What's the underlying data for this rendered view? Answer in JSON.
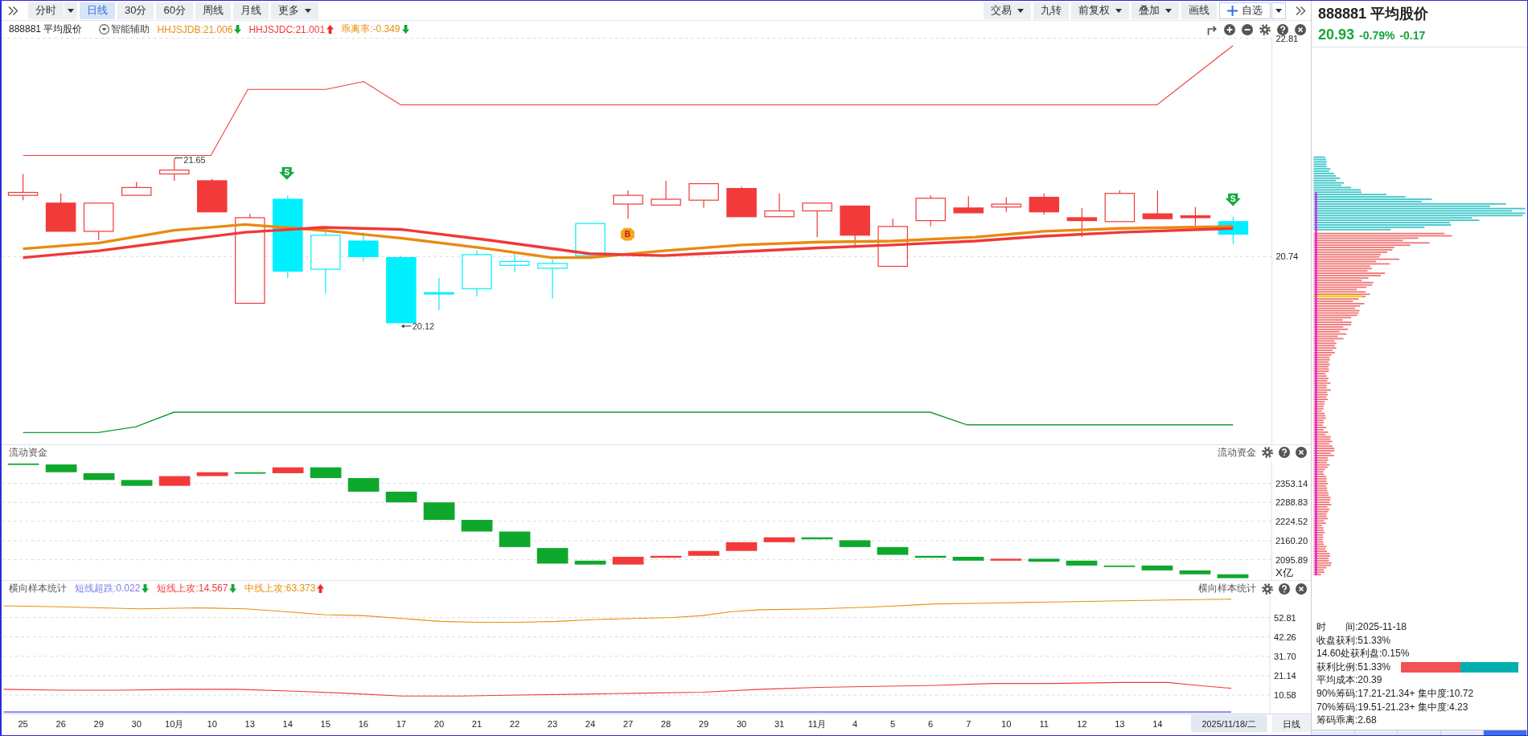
{
  "toolbar": {
    "left": [
      {
        "label": "分时",
        "kind": "split",
        "selected": false
      },
      {
        "label": "日线",
        "kind": "tab",
        "selected": true
      },
      {
        "label": "30分",
        "kind": "tab",
        "selected": false
      },
      {
        "label": "60分",
        "kind": "tab",
        "selected": false
      },
      {
        "label": "周线",
        "kind": "tab",
        "selected": false
      },
      {
        "label": "月线",
        "kind": "tab",
        "selected": false
      },
      {
        "label": "更多",
        "kind": "menu",
        "selected": false
      }
    ],
    "right": [
      {
        "label": "交易",
        "kind": "menu"
      },
      {
        "label": "九转",
        "kind": "plain"
      },
      {
        "label": "前复权",
        "kind": "menu"
      },
      {
        "label": "叠加",
        "kind": "menu"
      },
      {
        "label": "画线",
        "kind": "plain"
      },
      {
        "label": "自选",
        "kind": "add"
      }
    ]
  },
  "price_panel": {
    "title": "888881 平均股价",
    "assist": "智能辅助",
    "indicators": [
      {
        "text": "HHJSJDB:21.006",
        "color": "#e8900f",
        "rising": false
      },
      {
        "text": "HHJSJDC:21.001",
        "color": "#f23a3a",
        "rising": true
      },
      {
        "text": "乖离率:-0.349",
        "color": "#e8900f",
        "rising": false
      }
    ],
    "ticks": [
      "22.81",
      "20.74"
    ],
    "high_label": "21.65",
    "low_label": "20.12",
    "signals": [
      {
        "kind": "sell",
        "label": "S"
      },
      {
        "kind": "buy",
        "label": "B"
      },
      {
        "kind": "sell",
        "label": "S"
      }
    ]
  },
  "flow_panel": {
    "title": "流动资金",
    "title_right": "流动资金",
    "ticks": [
      "2353.14",
      "2288.83",
      "2224.52",
      "2160.20",
      "2095.89"
    ],
    "unit": "X亿"
  },
  "sample_panel": {
    "title": "横向样本统计",
    "title_right": "横向样本统计",
    "indicators": [
      {
        "text": "短线超跌:0.022",
        "color": "#7b7bea",
        "rising": false
      },
      {
        "text": "短线上攻:14.567",
        "color": "#f23a3a",
        "rising": false
      },
      {
        "text": "中线上攻:63.373",
        "color": "#e8900f",
        "rising": true
      }
    ],
    "ticks": [
      "52.81",
      "42.26",
      "31.70",
      "21.14",
      "10.58"
    ]
  },
  "date_axis": {
    "labels": [
      "25",
      "26",
      "29",
      "30",
      "10月",
      "10",
      "13",
      "14",
      "15",
      "16",
      "17",
      "20",
      "21",
      "22",
      "23",
      "24",
      "27",
      "28",
      "29",
      "30",
      "31",
      "11月",
      "4",
      "5",
      "6",
      "7",
      "10",
      "11",
      "12",
      "13",
      "14"
    ],
    "cursor_date": "2025/11/18/二",
    "period": "日线"
  },
  "quote": {
    "title": "888881 平均股价",
    "price": "20.93",
    "change_pct": "-0.79%",
    "change": "-0.17",
    "rising": false
  },
  "chip_info": {
    "lines": [
      {
        "kind": "text",
        "text": "时　　间:2025-11-18"
      },
      {
        "kind": "text",
        "text": "收盘获利:51.33%"
      },
      {
        "kind": "text",
        "text": "14.60处获利盘:0.15%"
      },
      {
        "kind": "ratio",
        "text": "获利比例:51.33%",
        "level": 0.51
      },
      {
        "kind": "text",
        "text": "平均成本:20.39"
      },
      {
        "kind": "text",
        "text": "90%筹码:17.21-21.34+ 集中度:10.72"
      },
      {
        "kind": "text",
        "text": "70%筹码:19.51-21.23+ 集中度:4.23"
      },
      {
        "kind": "text",
        "text": "筹码乖离:2.68"
      }
    ]
  },
  "panel_tabs": [
    {
      "selected": false
    },
    {
      "selected": false
    },
    {
      "selected": false
    },
    {
      "selected": false
    },
    {
      "selected": true
    }
  ]
}
